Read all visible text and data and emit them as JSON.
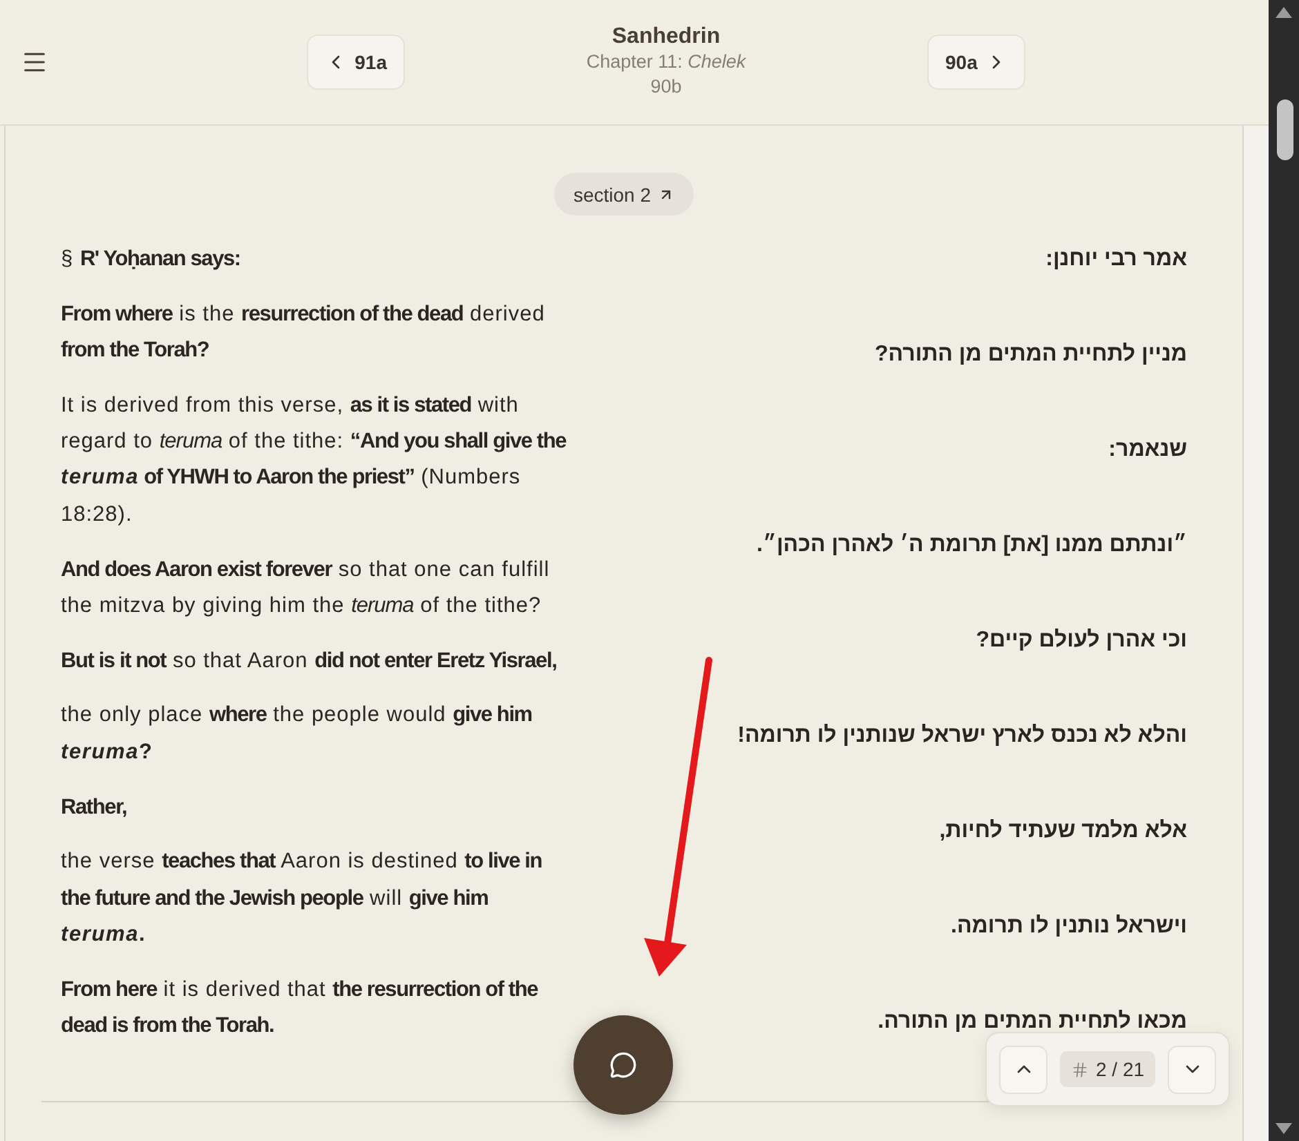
{
  "header": {
    "title": "Sanhedrin",
    "subtitle": "Chapter 11: *Chelek*",
    "page": "90b",
    "prev": {
      "label": "91a"
    },
    "next": {
      "label": "90a"
    }
  },
  "section_link": {
    "label": "section 2"
  },
  "english": [
    {
      "text": "§ **R' Yoḥanan says:**",
      "bold": false
    },
    {
      "text": "**From where** is the **resurrection of the dead** derived **from the Torah?**",
      "bold": false
    },
    {
      "text": "It is derived from this verse, **as it is stated** with regard to *teruma* of the tithe: **“And you shall give the *teruma* of YHWH to Aaron the priest”** (Numbers 18:28).",
      "bold": false
    },
    {
      "text": "**And does Aaron exist forever** so that one can fulfill the mitzva by giving him the *teruma* of the tithe?",
      "bold": false
    },
    {
      "text": "**But is it not** so that Aaron **did not enter Eretz Yisrael,**",
      "bold": false
    },
    {
      "text": "the only place **where** the people would **give him *teruma*?**",
      "bold": false
    },
    {
      "text": "Rather,",
      "bold": true
    },
    {
      "text": "the verse **teaches that** Aaron is destined **to live in the future and the Jewish people** will **give him *teruma*.**",
      "bold": false
    },
    {
      "text": "**From here** it is derived that **the resurrection of the dead is from the Torah.**",
      "bold": false
    }
  ],
  "hebrew": [
    "אמר רבי יוחנן:",
    "מניין לתחיית המתים מן התורה?",
    "שנאמר:",
    "״ונתתם ממנו [את] תרומת ה׳ לאהרן הכהן״.",
    "וכי אהרן לעולם קיים?",
    "והלא לא נכנס לארץ ישראל שנותנין לו תרומה!",
    "אלא מלמד שעתיד לחיות,",
    "וישראל נותנין לו תרומה.",
    "מכאו לתחיית המתים מן התורה."
  ],
  "pager": {
    "position": "2 / 21"
  }
}
